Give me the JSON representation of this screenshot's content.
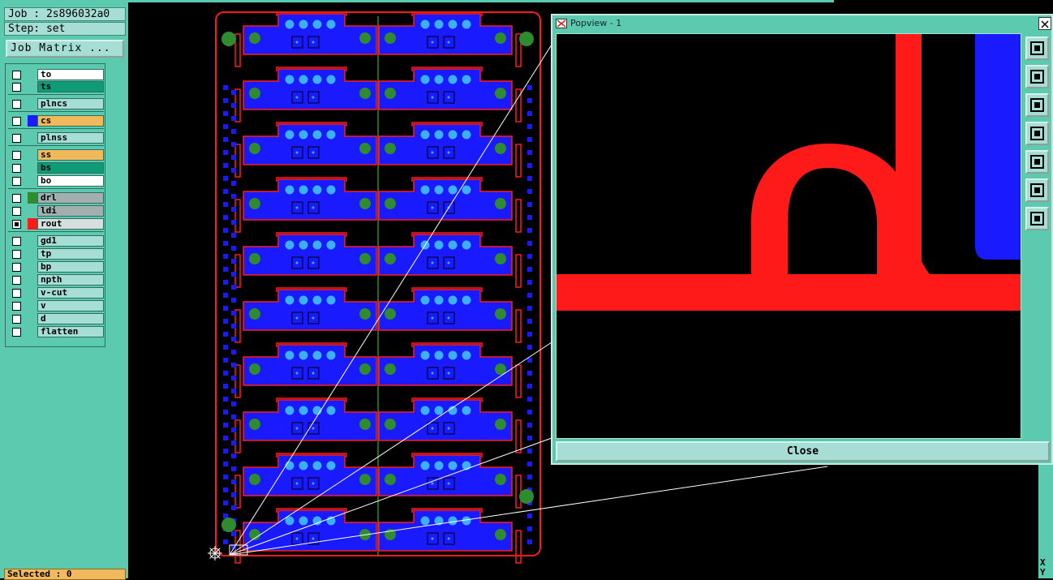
{
  "job": "Job : 2s896032a0",
  "step": "Step: set",
  "job_matrix_label": "Job Matrix ...",
  "layers": [
    {
      "name": "to",
      "bg": "#ffffff",
      "swatch": "",
      "checked": false
    },
    {
      "name": "ts",
      "bg": "#0f9a78",
      "swatch": "",
      "checked": false
    },
    {
      "name": "plncs",
      "bg": "#a6ded6",
      "swatch": "",
      "checked": false
    },
    {
      "name": "cs",
      "bg": "#f2b95c",
      "swatch": "#1a1aff",
      "checked": false
    },
    {
      "name": "plnss",
      "bg": "#a6ded6",
      "swatch": "",
      "checked": false
    },
    {
      "name": "ss",
      "bg": "#f2b95c",
      "swatch": "",
      "checked": false
    },
    {
      "name": "bs",
      "bg": "#0f9a78",
      "swatch": "",
      "checked": false
    },
    {
      "name": "bo",
      "bg": "#ffffff",
      "swatch": "",
      "checked": false
    },
    {
      "name": "drl",
      "bg": "#a3aeae",
      "swatch": "#2e8b2e",
      "checked": false
    },
    {
      "name": "ldi",
      "bg": "#a3aeae",
      "swatch": "",
      "checked": false
    },
    {
      "name": "rout",
      "bg": "#d6dede",
      "swatch": "#ff1a1a",
      "checked": true
    },
    {
      "name": "gd1",
      "bg": "#a6ded6",
      "swatch": "",
      "checked": false
    },
    {
      "name": "tp",
      "bg": "#a6ded6",
      "swatch": "",
      "checked": false
    },
    {
      "name": "bp",
      "bg": "#a6ded6",
      "swatch": "",
      "checked": false
    },
    {
      "name": "npth",
      "bg": "#a6ded6",
      "swatch": "",
      "checked": false
    },
    {
      "name": "v-cut",
      "bg": "#a6ded6",
      "swatch": "",
      "checked": false
    },
    {
      "name": "v",
      "bg": "#a6ded6",
      "swatch": "",
      "checked": false
    },
    {
      "name": "d",
      "bg": "#a6ded6",
      "swatch": "",
      "checked": false
    },
    {
      "name": "flatten",
      "bg": "#a6ded6",
      "swatch": "",
      "checked": false
    }
  ],
  "selected": "Selected : 0",
  "popview": {
    "title": "Popview - 1",
    "close_label": "Close",
    "tools": [
      "zoom-window-icon",
      "pan-up-icon",
      "pan-down-icon",
      "pan-left-icon",
      "pan-right-icon",
      "zoom-fit-icon",
      "zoom-home-icon"
    ]
  },
  "xy_label": "X\nY",
  "colors": {
    "panel": "#5ccaae",
    "board_outline": "#ff1a1a",
    "pad_blue": "#1a1aff",
    "pad_light": "#3ab0ff",
    "drill_green": "#2e8b2e"
  }
}
